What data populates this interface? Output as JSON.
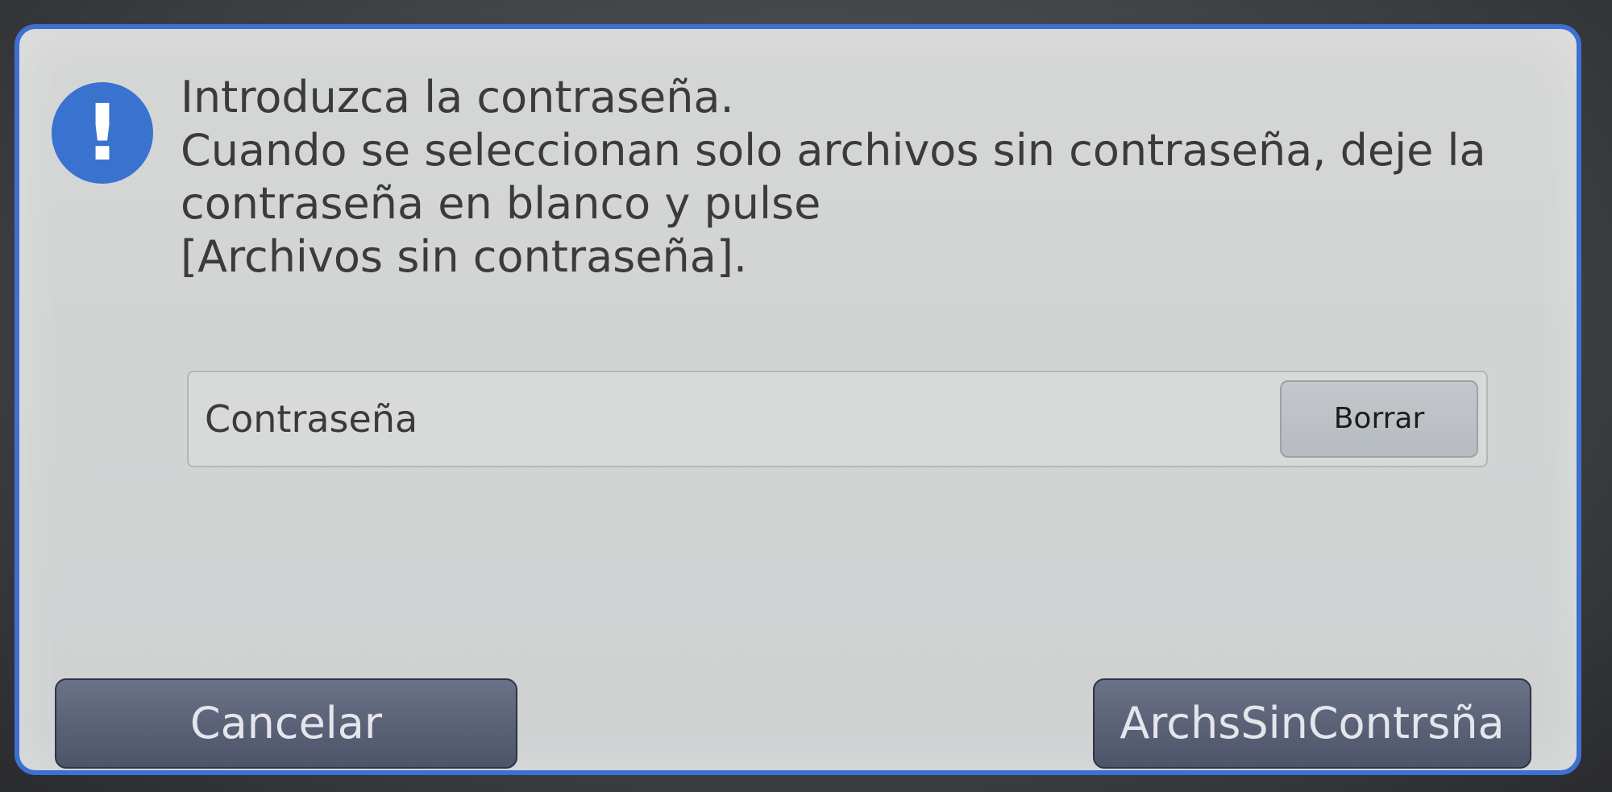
{
  "dialog": {
    "message_lines": [
      "Introduzca la contraseña.",
      "Cuando se seleccionan solo archivos sin contraseña, deje la",
      "contraseña en blanco y pulse",
      "[Archivos sin contraseña]."
    ],
    "icon": {
      "name": "exclamation-icon",
      "glyph": "!"
    },
    "password_field": {
      "label": "Contraseña",
      "clear_label": "Borrar"
    },
    "buttons": {
      "cancel_label": "Cancelar",
      "no_password_label": "ArchsSinContrsña"
    }
  },
  "colors": {
    "accent": "#3f6fd0",
    "icon_background": "#3a72d0",
    "dialog_background": "#d4d6d5",
    "footer_button": "#5a6176"
  }
}
